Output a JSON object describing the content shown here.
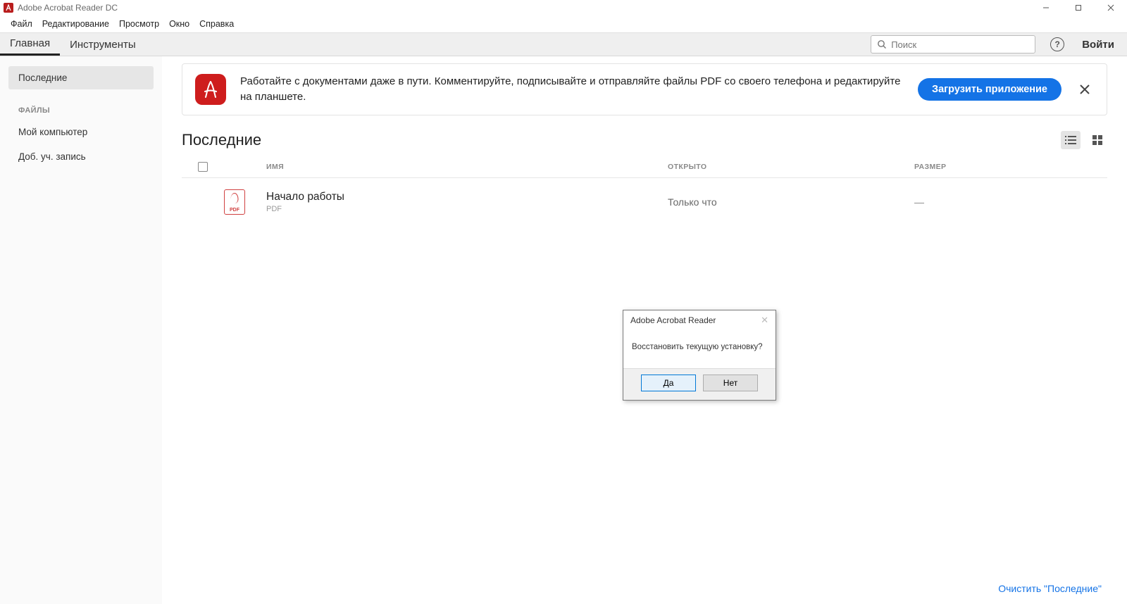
{
  "titlebar": {
    "app_name": "Adobe Acrobat Reader DC",
    "icon_glyph": "A"
  },
  "menubar": [
    "Файл",
    "Редактирование",
    "Просмотр",
    "Окно",
    "Справка"
  ],
  "toolbar": {
    "tabs": [
      {
        "label": "Главная",
        "active": true
      },
      {
        "label": "Инструменты",
        "active": false
      }
    ],
    "search_placeholder": "Поиск",
    "signin": "Войти"
  },
  "sidebar": {
    "nav": [
      {
        "label": "Последние",
        "active": true
      }
    ],
    "section_label": "ФАЙЛЫ",
    "files_nav": [
      {
        "label": "Мой компьютер"
      },
      {
        "label": "Доб. уч. запись"
      }
    ]
  },
  "promo": {
    "text": "Работайте с документами даже в пути. Комментируйте, подписывайте и отправляйте файлы PDF со своего телефона и редактируйте на планшете.",
    "button": "Загрузить приложение"
  },
  "main": {
    "title": "Последние",
    "columns": {
      "name": "ИМЯ",
      "opened": "ОТКРЫТО",
      "size": "РАЗМЕР"
    },
    "rows": [
      {
        "name": "Начало работы",
        "type": "PDF",
        "opened": "Только что",
        "size": "—"
      }
    ],
    "clear_link": "Очистить \"Последние\""
  },
  "dialog": {
    "title": "Adobe Acrobat Reader",
    "message": "Восстановить текущую установку?",
    "yes": "Да",
    "no": "Нет"
  }
}
